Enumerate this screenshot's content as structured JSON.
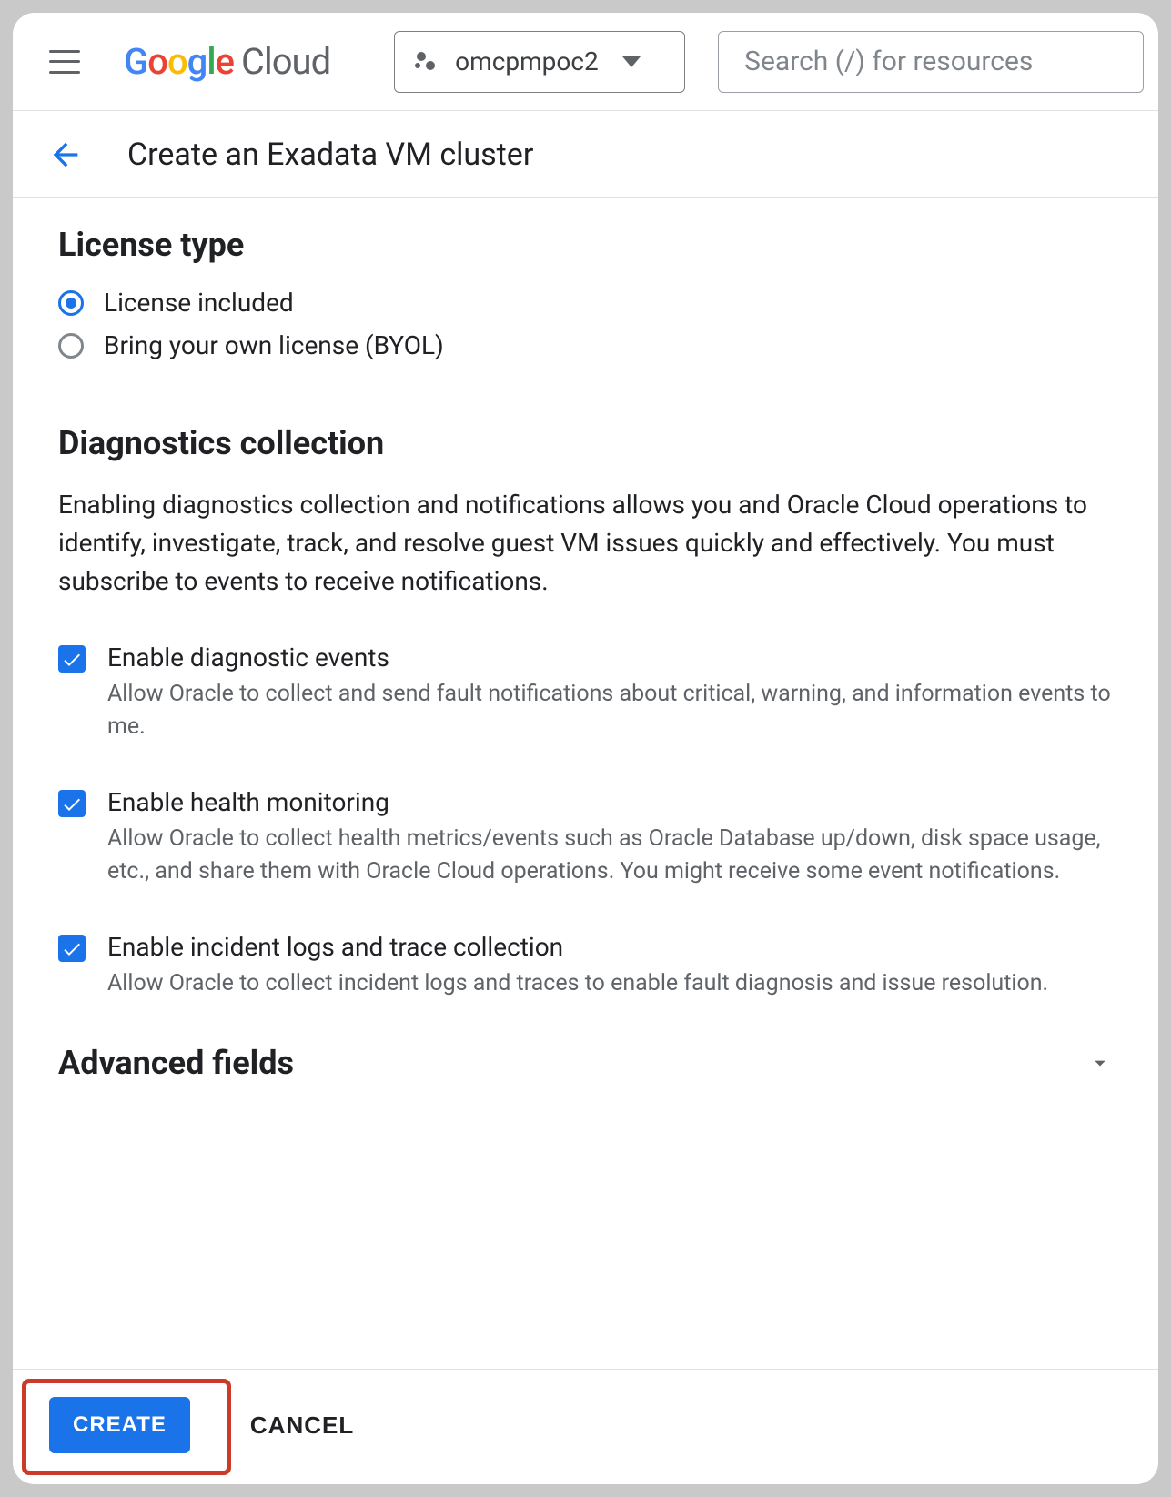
{
  "header": {
    "project": "omcpmpoc2",
    "search_placeholder": "Search (/) for resources"
  },
  "page": {
    "title": "Create an Exadata VM cluster"
  },
  "license": {
    "heading": "License type",
    "options": [
      {
        "label": "License included",
        "selected": true
      },
      {
        "label": "Bring your own license (BYOL)",
        "selected": false
      }
    ]
  },
  "diagnostics": {
    "heading": "Diagnostics collection",
    "description": "Enabling diagnostics collection and notifications allows you and Oracle Cloud operations to identify, investigate, track, and resolve guest VM issues quickly and effectively. You must subscribe to events to receive notifications.",
    "items": [
      {
        "title": "Enable diagnostic events",
        "desc": "Allow Oracle to collect and send fault notifications about critical, warning, and information events to me.",
        "checked": true
      },
      {
        "title": "Enable health monitoring",
        "desc": "Allow Oracle to collect health metrics/events such as Oracle Database up/down, disk space usage, etc., and share them with Oracle Cloud operations. You might receive some event notifications.",
        "checked": true
      },
      {
        "title": "Enable incident logs and trace collection",
        "desc": "Allow Oracle to collect incident logs and traces to enable fault diagnosis and issue resolution.",
        "checked": true
      }
    ]
  },
  "advanced": {
    "heading": "Advanced fields"
  },
  "footer": {
    "create": "CREATE",
    "cancel": "CANCEL"
  }
}
